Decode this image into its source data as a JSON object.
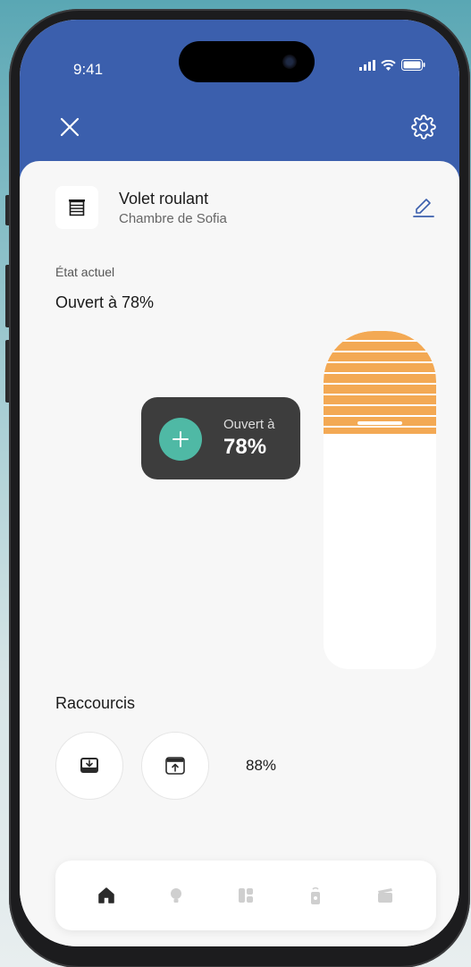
{
  "status_bar": {
    "time": "9:41"
  },
  "device": {
    "name": "Volet roulant",
    "room": "Chambre de Sofia",
    "icon": "roller-shutter-icon"
  },
  "state": {
    "label": "État actuel",
    "value": "Ouvert à 78%",
    "open_fraction": 0.78
  },
  "tooltip": {
    "label": "Ouvert à",
    "value": "78%"
  },
  "shortcuts": {
    "title": "Raccourcis",
    "items": [
      {
        "icon": "shutter-down-icon"
      },
      {
        "icon": "shutter-up-icon"
      },
      {
        "label": "88%"
      }
    ]
  },
  "nav": {
    "items": [
      {
        "icon": "home-icon",
        "active": true
      },
      {
        "icon": "light-bulb-icon",
        "active": false
      },
      {
        "icon": "shutter-icon",
        "active": false
      },
      {
        "icon": "remote-icon",
        "active": false
      },
      {
        "icon": "scene-icon",
        "active": false
      }
    ]
  },
  "colors": {
    "header": "#3b5fad",
    "accent": "#4fb9a5",
    "shutter": "#f3a954",
    "tooltip_bg": "#3d3d3d"
  }
}
